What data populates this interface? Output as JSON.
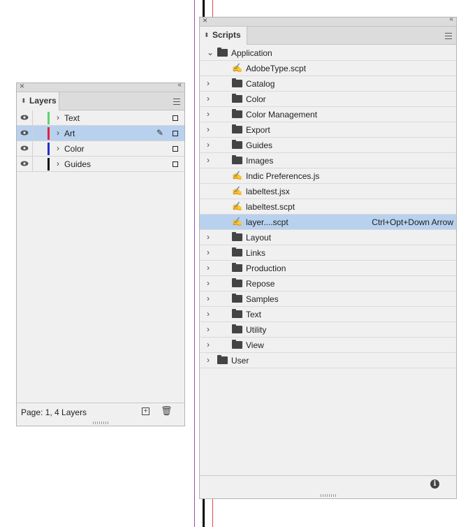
{
  "layers_panel": {
    "tab_label": "Layers",
    "layers": [
      {
        "name": "Text",
        "color": "#5cd36a",
        "selected": false,
        "locked_pen": false
      },
      {
        "name": "Art",
        "color": "#e0233a",
        "selected": true,
        "locked_pen": true
      },
      {
        "name": "Color",
        "color": "#2030c8",
        "selected": false,
        "locked_pen": false
      },
      {
        "name": "Guides",
        "color": "#111111",
        "selected": false,
        "locked_pen": false
      }
    ],
    "footer_status": "Page: 1, 4 Layers"
  },
  "scripts_panel": {
    "tab_label": "Scripts",
    "items": [
      {
        "label": "Application",
        "kind": "folder",
        "level": 0,
        "expanded": true
      },
      {
        "label": "AdobeType.scpt",
        "kind": "script",
        "level": 1
      },
      {
        "label": "Catalog",
        "kind": "folder",
        "level": 1
      },
      {
        "label": "Color",
        "kind": "folder",
        "level": 1
      },
      {
        "label": "Color Management",
        "kind": "folder",
        "level": 1
      },
      {
        "label": "Export",
        "kind": "folder",
        "level": 1
      },
      {
        "label": "Guides",
        "kind": "folder",
        "level": 1
      },
      {
        "label": "Images",
        "kind": "folder",
        "level": 1
      },
      {
        "label": "Indic Preferences.js",
        "kind": "script",
        "level": 1
      },
      {
        "label": "labeltest.jsx",
        "kind": "script",
        "level": 1
      },
      {
        "label": "labeltest.scpt",
        "kind": "script",
        "level": 1
      },
      {
        "label": "layer....scpt",
        "kind": "script",
        "level": 1,
        "selected": true,
        "shortcut": "Ctrl+Opt+Down Arrow"
      },
      {
        "label": "Layout",
        "kind": "folder",
        "level": 1
      },
      {
        "label": "Links",
        "kind": "folder",
        "level": 1
      },
      {
        "label": "Production",
        "kind": "folder",
        "level": 1
      },
      {
        "label": "Repose",
        "kind": "folder",
        "level": 1
      },
      {
        "label": "Samples",
        "kind": "folder",
        "level": 1
      },
      {
        "label": "Text",
        "kind": "folder",
        "level": 1
      },
      {
        "label": "Utility",
        "kind": "folder",
        "level": 1
      },
      {
        "label": "View",
        "kind": "folder",
        "level": 1
      },
      {
        "label": "User",
        "kind": "folder",
        "level": 0
      }
    ]
  }
}
